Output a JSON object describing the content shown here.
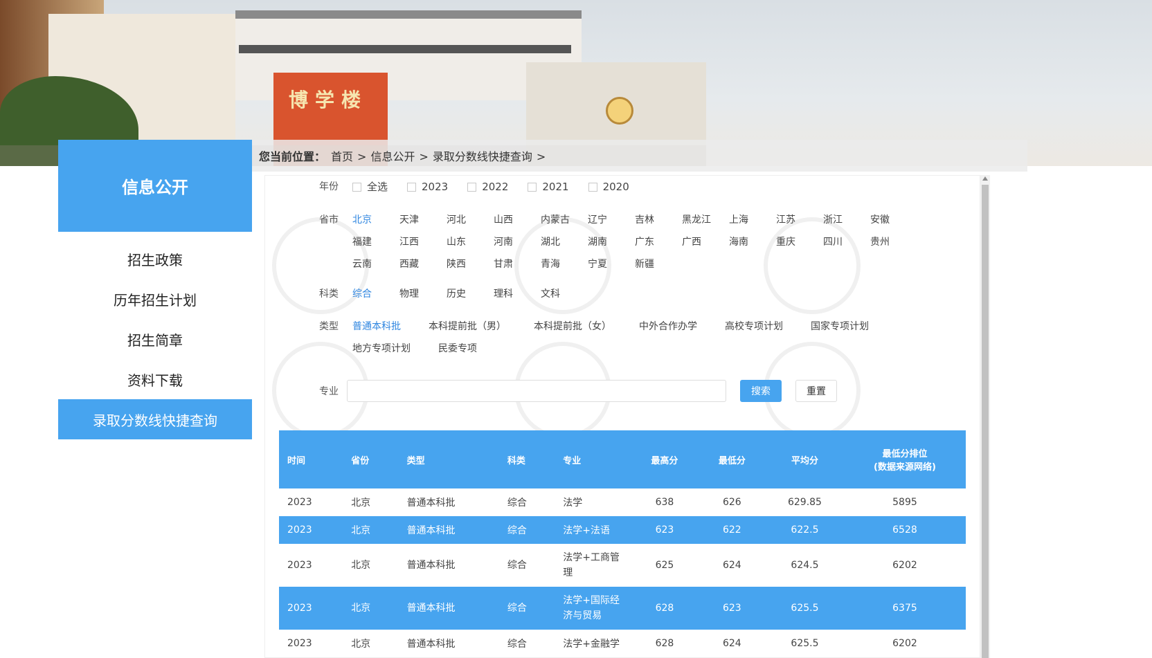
{
  "banner": {
    "building_sign": "博学楼"
  },
  "sidebar": {
    "title": "信息公开",
    "items": [
      {
        "label": "招生政策",
        "active": false
      },
      {
        "label": "历年招生计划",
        "active": false
      },
      {
        "label": "招生简章",
        "active": false
      },
      {
        "label": "资料下载",
        "active": false
      },
      {
        "label": "录取分数线快捷查询",
        "active": true
      }
    ]
  },
  "breadcrumb": {
    "label": "您当前位置：",
    "items": [
      "首页",
      "信息公开",
      "录取分数线快捷查询"
    ],
    "separator": ">"
  },
  "filters": {
    "year": {
      "label": "年份",
      "options": [
        "全选",
        "2023",
        "2022",
        "2021",
        "2020"
      ]
    },
    "province": {
      "label": "省市",
      "options": [
        "北京",
        "天津",
        "河北",
        "山西",
        "内蒙古",
        "辽宁",
        "吉林",
        "黑龙江",
        "上海",
        "江苏",
        "浙江",
        "安徽",
        "福建",
        "江西",
        "山东",
        "河南",
        "湖北",
        "湖南",
        "广东",
        "广西",
        "海南",
        "重庆",
        "四川",
        "贵州",
        "云南",
        "西藏",
        "陕西",
        "甘肃",
        "青海",
        "宁夏",
        "新疆"
      ],
      "selected": "北京"
    },
    "subject": {
      "label": "科类",
      "options": [
        "综合",
        "物理",
        "历史",
        "理科",
        "文科"
      ],
      "selected": "综合"
    },
    "type": {
      "label": "类型",
      "options": [
        "普通本科批",
        "本科提前批（男）",
        "本科提前批（女）",
        "中外合作办学",
        "高校专项计划",
        "国家专项计划",
        "地方专项计划",
        "民委专项"
      ],
      "selected": "普通本科批"
    },
    "major": {
      "label": "专业",
      "value": "",
      "placeholder": ""
    },
    "search_label": "搜索",
    "reset_label": "重置"
  },
  "table": {
    "headers": [
      "时间",
      "省份",
      "类型",
      "科类",
      "专业",
      "最高分",
      "最低分",
      "平均分",
      "最低分排位\n(数据来源网络)"
    ],
    "rows": [
      {
        "cells": [
          "2023",
          "北京",
          "普通本科批",
          "综合",
          "法学",
          "638",
          "626",
          "629.85",
          "5895"
        ],
        "highlight": false
      },
      {
        "cells": [
          "2023",
          "北京",
          "普通本科批",
          "综合",
          "法学+法语",
          "623",
          "622",
          "622.5",
          "6528"
        ],
        "highlight": true
      },
      {
        "cells": [
          "2023",
          "北京",
          "普通本科批",
          "综合",
          "法学+工商管理",
          "625",
          "624",
          "624.5",
          "6202"
        ],
        "highlight": false
      },
      {
        "cells": [
          "2023",
          "北京",
          "普通本科批",
          "综合",
          "法学+国际经济与贸易",
          "628",
          "623",
          "625.5",
          "6375"
        ],
        "highlight": true
      },
      {
        "cells": [
          "2023",
          "北京",
          "普通本科批",
          "综合",
          "法学+金融学",
          "628",
          "624",
          "625.5",
          "6202"
        ],
        "highlight": false
      }
    ]
  },
  "colors": {
    "accent": "#47a4ef",
    "selected_link": "#2f86e0"
  }
}
